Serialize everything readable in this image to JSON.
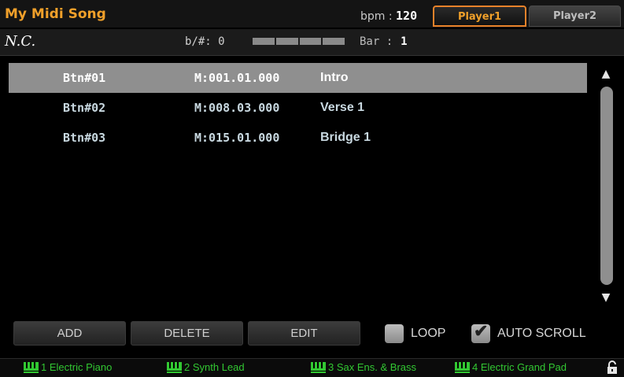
{
  "header": {
    "song_title": "My Midi Song",
    "bpm_label": "bpm :",
    "bpm_value": "120",
    "tabs": [
      {
        "label": "Player1"
      },
      {
        "label": "Player2"
      }
    ]
  },
  "status": {
    "chord": "N.C.",
    "transpose_label": "b/#: 0",
    "bar_label": "Bar :",
    "bar_value": "1"
  },
  "markers": [
    {
      "button": "Btn#01",
      "position": "M:001.01.000",
      "name": "Intro"
    },
    {
      "button": "Btn#02",
      "position": "M:008.03.000",
      "name": "Verse 1"
    },
    {
      "button": "Btn#03",
      "position": "M:015.01.000",
      "name": "Bridge 1"
    }
  ],
  "actions": {
    "add": "ADD",
    "delete": "DELETE",
    "edit": "EDIT"
  },
  "options": {
    "loop_label": "LOOP",
    "loop_checked": false,
    "auto_scroll_label": "AUTO SCROLL",
    "auto_scroll_checked": true
  },
  "tracks": [
    {
      "number": "1",
      "name": "Electric Piano"
    },
    {
      "number": "2",
      "name": "Synth Lead"
    },
    {
      "number": "3",
      "name": "Sax Ens. & Brass"
    },
    {
      "number": "4",
      "name": "Electric Grand Pad"
    }
  ],
  "colors": {
    "accent": "#f0a02a",
    "track_green": "#32c832",
    "selection": "#8f8f8f"
  },
  "icons": [
    "scroll-up-icon",
    "scroll-down-icon",
    "keyboard-icon",
    "lock-icon",
    "checkmark-icon"
  ]
}
